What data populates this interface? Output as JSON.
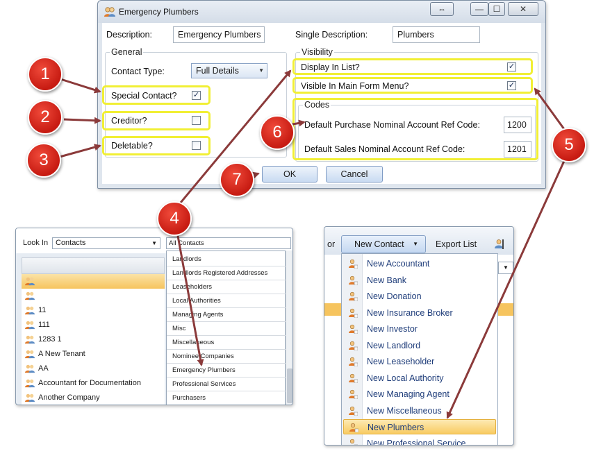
{
  "dialog": {
    "title": "Emergency Plumbers",
    "controls": {
      "restore": "⇔",
      "minimize": "—",
      "maximize": "☐",
      "close": "✕"
    },
    "description_label": "Description:",
    "description_value": "Emergency Plumbers",
    "single_description_label": "Single Description:",
    "single_description_value": "Plumbers",
    "general": {
      "title": "General",
      "contact_type_label": "Contact Type:",
      "contact_type_value": "Full Details",
      "special_contact_label": "Special Contact?",
      "special_contact_checked": true,
      "creditor_label": "Creditor?",
      "creditor_checked": false,
      "deletable_label": "Deletable?",
      "deletable_checked": false
    },
    "visibility": {
      "title": "Visibility",
      "display_in_list_label": "Display In List?",
      "display_in_list_checked": true,
      "visible_in_menu_label": "Visible In Main Form Menu?",
      "visible_in_menu_checked": true
    },
    "codes": {
      "title": "Codes",
      "purchase_label": "Default Purchase Nominal Account Ref Code:",
      "purchase_value": "1200",
      "sales_label": "Default Sales Nominal Account Ref Code:",
      "sales_value": "1201"
    },
    "ok_label": "OK",
    "cancel_label": "Cancel"
  },
  "markers": [
    "1",
    "2",
    "3",
    "4",
    "5",
    "6",
    "7"
  ],
  "lookin": {
    "label": "Look In",
    "value": "Contacts",
    "filter_value": "All Contacts",
    "rows": [
      "",
      "",
      "11",
      "111",
      "1283 1",
      "A New Tenant",
      "AA",
      "Accountant for Documentation",
      "Another Company"
    ],
    "dropdown_items": [
      "Landlords",
      "Landlords Registered Addresses",
      "Leaseholders",
      "Local Authorities",
      "Managing Agents",
      "Misc",
      "Miscellaneous",
      "Nominee Companies",
      "Emergency Plumbers",
      "Professional Services",
      "Purchasers"
    ]
  },
  "newcontact": {
    "or_text": "or",
    "button_label": "New Contact",
    "export_label": "Export List",
    "items": [
      "New Accountant",
      "New Bank",
      "New Donation",
      "New Insurance Broker",
      "New Investor",
      "New Landlord",
      "New Leaseholder",
      "New Local Authority",
      "New Managing Agent",
      "New Miscellaneous",
      "New Plumbers",
      "New Professional Service"
    ],
    "selected_item": "New Plumbers"
  },
  "colors": {
    "highlight": "#f1ef34",
    "marker_red": "#d42a1e",
    "arrow": "#8b3a3a",
    "selection": "#f8cb62"
  }
}
